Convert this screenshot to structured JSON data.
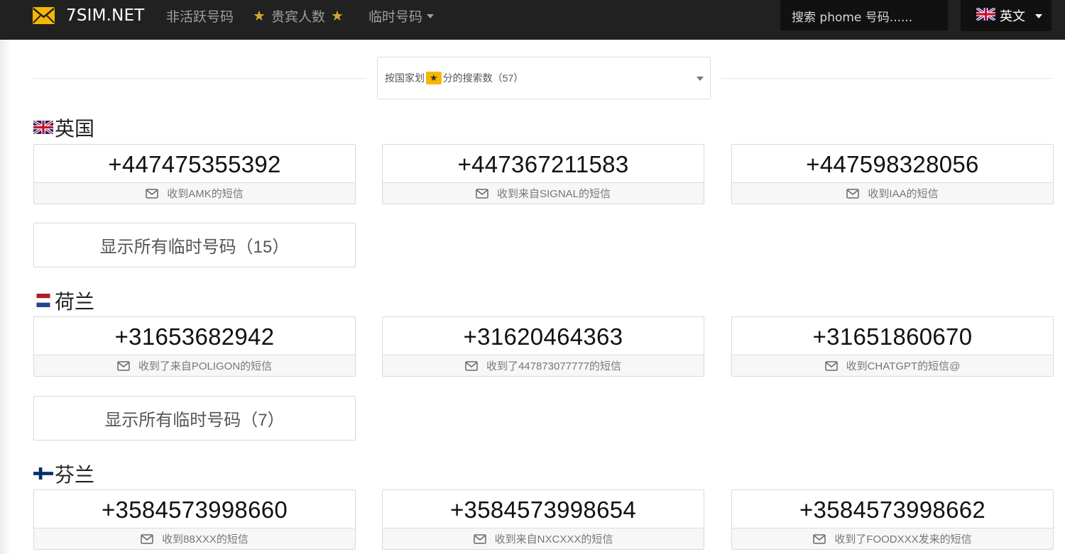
{
  "navbar": {
    "brand": "7SIM.NET",
    "inactive": "非活跃号码",
    "vip": "贵宾人数",
    "temp": "临时号码",
    "search_placeholder": "搜索 phome 号码......",
    "language": "英文"
  },
  "filter": {
    "prefix": "按国家划",
    "badge": "★",
    "suffix": "分的搜索数（57）"
  },
  "sections": [
    {
      "country": "英国",
      "flag": "gb",
      "cards": [
        {
          "number": "+447475355392",
          "message": "收到AMK的短信"
        },
        {
          "number": "+447367211583",
          "message": "收到来自SIGNAL的短信"
        },
        {
          "number": "+447598328056",
          "message": "收到IAA的短信"
        }
      ],
      "show_all": "显示所有临时号码（15）"
    },
    {
      "country": "荷兰",
      "flag": "nl",
      "cards": [
        {
          "number": "+31653682942",
          "message": "收到了来自POLIGON的短信"
        },
        {
          "number": "+31620464363",
          "message": "收到了447873077777的短信"
        },
        {
          "number": "+31651860670",
          "message": "收到CHATGPT的短信@"
        }
      ],
      "show_all": "显示所有临时号码（7）"
    },
    {
      "country": "芬兰",
      "flag": "fi",
      "cards": [
        {
          "number": "+3584573998660",
          "message": "收到88XXX的短信"
        },
        {
          "number": "+3584573998654",
          "message": "收到来自NXCXXX的短信"
        },
        {
          "number": "+3584573998662",
          "message": "收到了FOODXXX发来的短信"
        }
      ]
    }
  ],
  "colors": {
    "navbar_bg": "#212121",
    "nav_text": "#9e9e9e",
    "star": "#d4a72c",
    "brand_icon": "#f5b800"
  }
}
